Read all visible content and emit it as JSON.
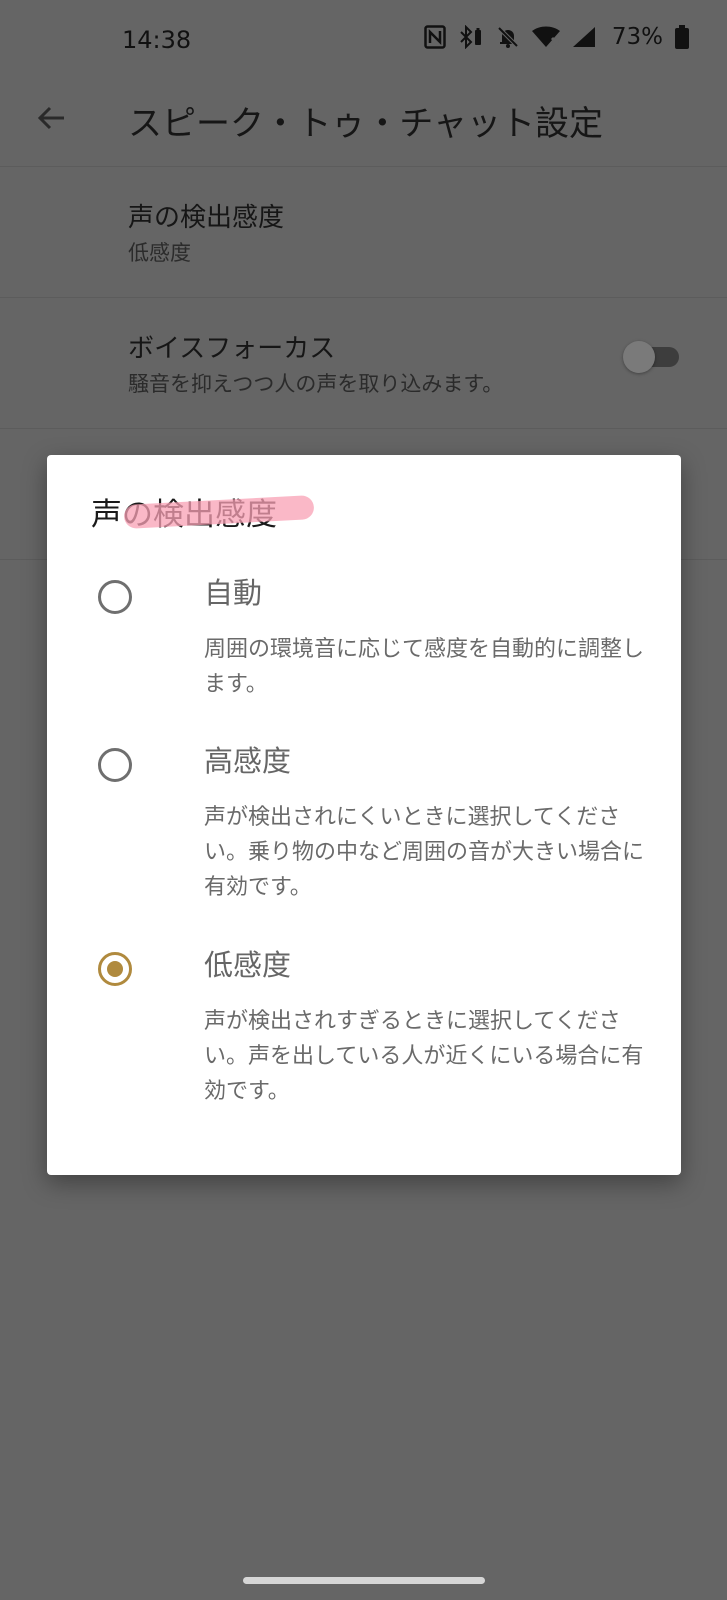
{
  "status_bar": {
    "time": "14:38",
    "battery": "73%",
    "icons": [
      "nfc-icon",
      "bluetooth-battery-icon",
      "bell-off-icon",
      "wifi-icon",
      "signal-icon",
      "battery-icon"
    ]
  },
  "app_bar": {
    "title": "スピーク・トゥ・チャット設定",
    "back_icon": "arrow-back-icon"
  },
  "settings": {
    "detection": {
      "title": "声の検出感度",
      "summary": "低感度"
    },
    "voice_focus": {
      "title": "ボイスフォーカス",
      "summary": "騒音を抑えつつ人の声を取り込みます。",
      "enabled": false
    }
  },
  "dialog": {
    "title": "声の検出感度",
    "selected": "low",
    "options": [
      {
        "key": "auto",
        "label": "自動",
        "description": "周囲の環境音に応じて感度を自動的に調整します。"
      },
      {
        "key": "high",
        "label": "高感度",
        "description": "声が検出されにくいときに選択してください。乗り物の中など周囲の音が大きい場合に有効です。"
      },
      {
        "key": "low",
        "label": "低感度",
        "description": "声が検出されすぎるときに選択してください。声を出している人が近くにいる場合に有効です。"
      }
    ]
  },
  "colors": {
    "accent": "#b08a3e",
    "scrim_background": "#656565",
    "dialog_background": "#ffffff",
    "highlight_marker": "#f8a0b4"
  }
}
